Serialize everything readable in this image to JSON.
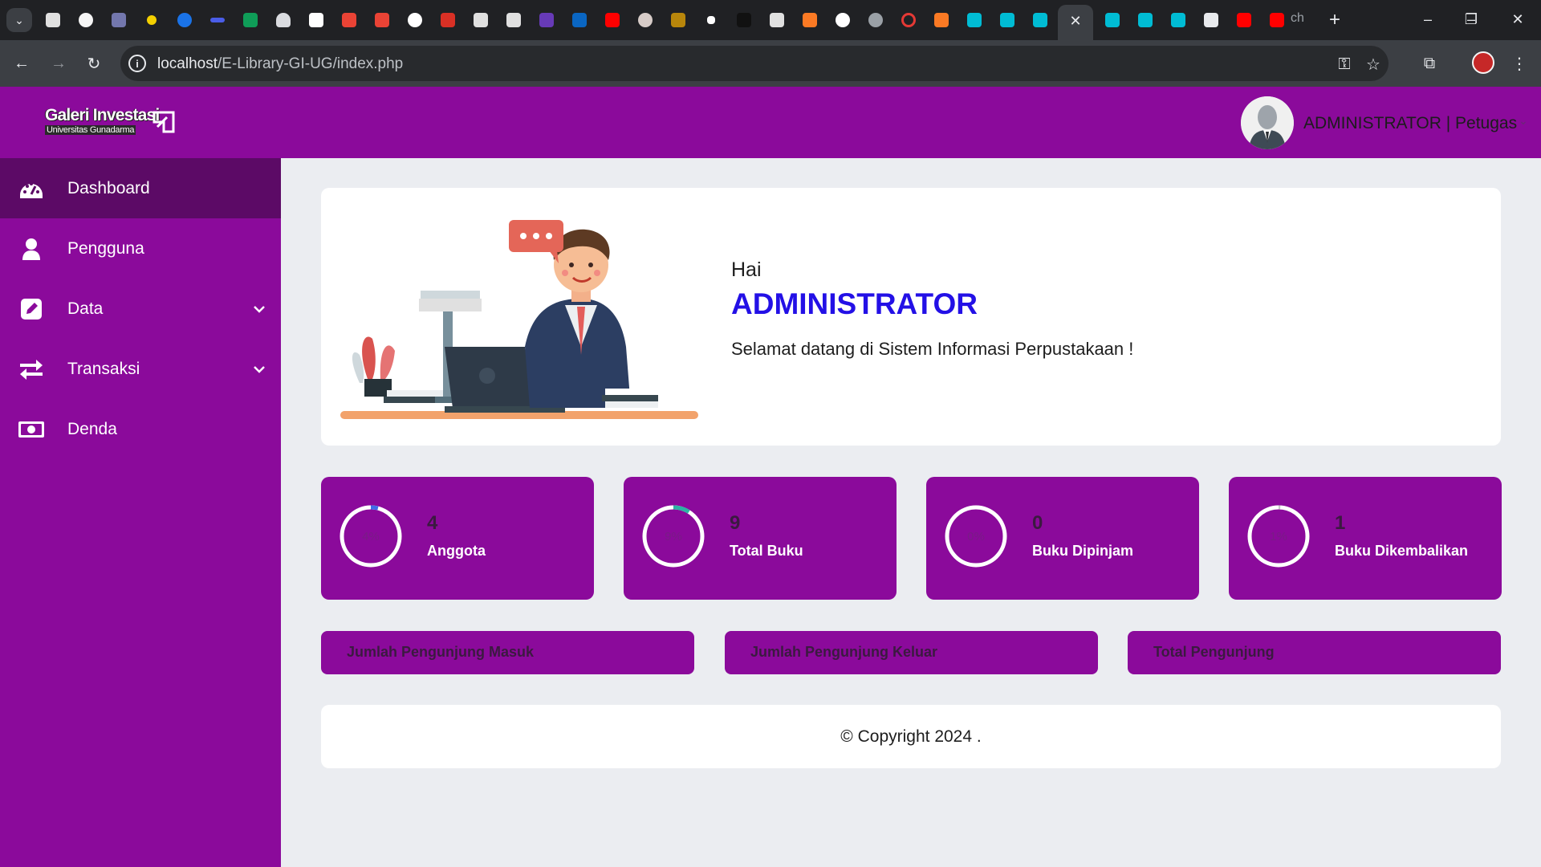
{
  "browser": {
    "url_host": "localhost",
    "url_path": "/E-Library-GI-UG/index.php",
    "tab_overflow_text": "ch"
  },
  "header": {
    "logo_text": "Galeri Investasi",
    "logo_subtext": "Universitas Gunadarma",
    "user_name": "ADMINISTRATOR",
    "user_role": "Petugas",
    "user_label": "ADMINISTRATOR | Petugas"
  },
  "sidebar": {
    "items": [
      {
        "label": "Dashboard",
        "icon": "tachometer-icon",
        "active": true
      },
      {
        "label": "Pengguna",
        "icon": "user-icon"
      },
      {
        "label": "Data",
        "icon": "edit-icon",
        "has_submenu": true
      },
      {
        "label": "Transaksi",
        "icon": "exchange-arrows-icon",
        "has_submenu": true
      },
      {
        "label": "Denda",
        "icon": "money-bill-icon"
      }
    ]
  },
  "welcome": {
    "greeting": "Hai",
    "name": "ADMINISTRATOR",
    "message": "Selamat datang di Sistem Informasi Perpustakaan !"
  },
  "stats": [
    {
      "percent_text": "4%",
      "percent": 4,
      "value": "4",
      "label": "Anggota"
    },
    {
      "percent_text": "9%",
      "percent": 9,
      "value": "9",
      "label": "Total Buku"
    },
    {
      "percent_text": "0%",
      "percent": 0,
      "value": "0",
      "label": "Buku Dipinjam"
    },
    {
      "percent_text": "1%",
      "percent": 1,
      "value": "1",
      "label": "Buku Dikembalikan"
    }
  ],
  "visitors": [
    {
      "label": "Jumlah Pengunjung Masuk"
    },
    {
      "label": "Jumlah Pengunjung Keluar"
    },
    {
      "label": "Total Pengunjung"
    }
  ],
  "footer": {
    "copyright": "© Copyright 2024 ."
  },
  "colors": {
    "brand_purple": "#8b0a9b",
    "sidebar_active": "#5c0a66",
    "accent_blue": "#2310e6"
  }
}
